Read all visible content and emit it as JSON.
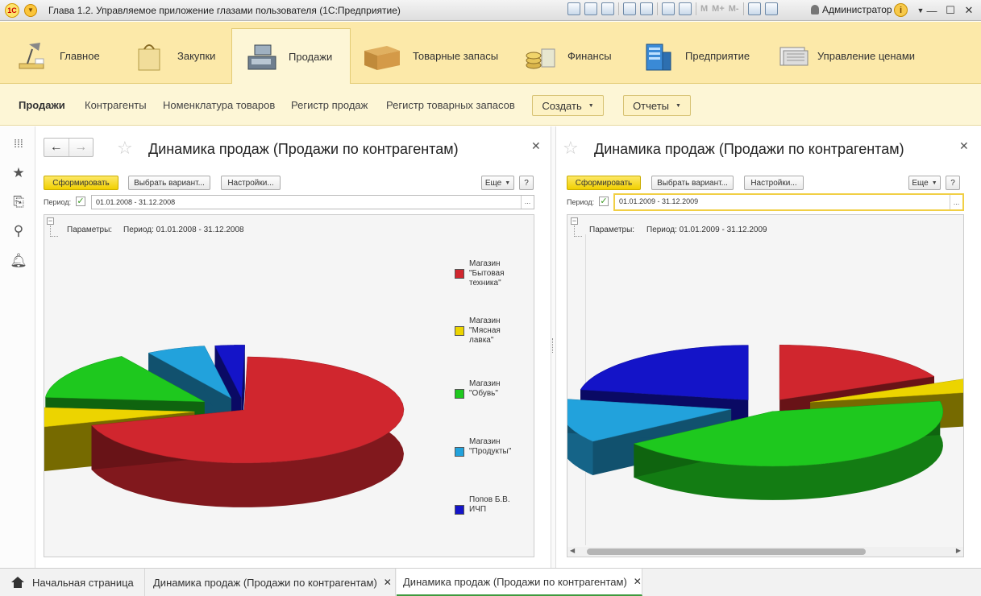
{
  "window": {
    "title": "Глава 1.2. Управляемое приложение глазами пользователя  (1С:Предприятие)",
    "logo": "1С",
    "user": "Администратор",
    "m_buttons": [
      "M",
      "M+",
      "M-"
    ]
  },
  "sections": [
    {
      "label": "Главное",
      "icon": "desk-lamp-icon"
    },
    {
      "label": "Закупки",
      "icon": "shopping-bag-icon"
    },
    {
      "label": "Продажи",
      "icon": "cash-register-icon",
      "active": true
    },
    {
      "label": "Товарные запасы",
      "icon": "box-icon"
    },
    {
      "label": "Финансы",
      "icon": "coins-icon"
    },
    {
      "label": "Предприятие",
      "icon": "building-icon"
    },
    {
      "label": "Управление ценами",
      "icon": "price-tags-icon"
    }
  ],
  "subnav": {
    "title": "Продажи",
    "links": [
      "Контрагенты",
      "Номенклатура товаров",
      "Регистр продаж",
      "Регистр товарных запасов"
    ],
    "create": "Создать",
    "reports": "Отчеты"
  },
  "panels": [
    {
      "title": "Динамика продаж (Продажи по контрагентам)",
      "generate": "Сформировать",
      "choose_variant": "Выбрать вариант...",
      "settings": "Настройки...",
      "more": "Еще",
      "help": "?",
      "period_label": "Период:",
      "period_value": "01.01.2008 - 31.12.2008",
      "params_label": "Параметры:",
      "params_value": "Период: 01.01.2008 - 31.12.2008"
    },
    {
      "title": "Динамика продаж (Продажи по контрагентам)",
      "generate": "Сформировать",
      "choose_variant": "Выбрать вариант...",
      "settings": "Настройки...",
      "more": "Еще",
      "help": "?",
      "period_label": "Период:",
      "period_value": "01.01.2009 - 31.12.2009",
      "params_label": "Параметры:",
      "params_value": "Период: 01.01.2009 - 31.12.2009"
    }
  ],
  "legend": [
    {
      "label": "Магазин\n\"Бытовая\nтехника\"",
      "color": "#d0262e"
    },
    {
      "label": "Магазин\n\"Мясная\nлавка\"",
      "color": "#ecd400"
    },
    {
      "label": "Магазин\n\"Обувь\"",
      "color": "#1ec81e"
    },
    {
      "label": "Магазин\n\"Продукты\"",
      "color": "#22a2dc"
    },
    {
      "label": "Попов Б.В.\nИЧП",
      "color": "#1414c8"
    }
  ],
  "chart_data": [
    {
      "type": "pie",
      "title": "",
      "categories": [
        "Магазин \"Бытовая техника\"",
        "Магазин \"Мясная лавка\"",
        "Магазин \"Обувь\"",
        "Магазин \"Продукты\"",
        "Попов Б.В. ИЧП"
      ],
      "values": [
        70,
        6,
        15,
        6,
        3
      ],
      "colors": [
        "#d0262e",
        "#ecd400",
        "#1ec81e",
        "#22a2dc",
        "#1414c8"
      ]
    },
    {
      "type": "pie",
      "title": "",
      "categories": [
        "Магазин \"Бытовая техника\"",
        "Магазин \"Мясная лавка\"",
        "Магазин \"Обувь\"",
        "Магазин \"Продукты\"",
        "Попов Б.В. ИЧП"
      ],
      "values": [
        18,
        4,
        43,
        13,
        22
      ],
      "colors": [
        "#d0262e",
        "#ecd400",
        "#1ec81e",
        "#22a2dc",
        "#1414c8"
      ]
    }
  ],
  "tabs": {
    "home": "Начальная страница",
    "tab1": "Динамика продаж (Продажи по контрагентам)",
    "tab2": "Динамика продаж (Продажи по контрагентам)"
  }
}
